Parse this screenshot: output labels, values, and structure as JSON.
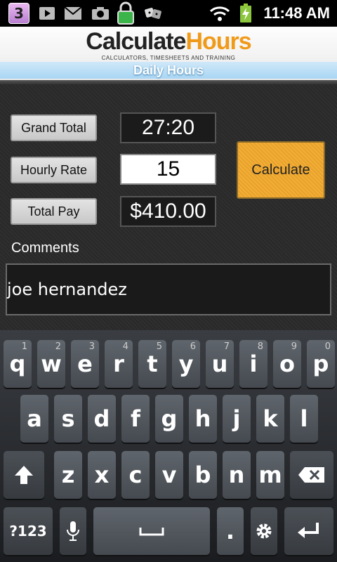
{
  "status_bar": {
    "notification_count": "3",
    "time": "11:48 AM",
    "icons": [
      "notification-badge-icon",
      "youtube-icon",
      "gmail-icon",
      "camera-icon",
      "lock-icon",
      "dice-icon",
      "wifi-icon",
      "battery-charging-icon"
    ]
  },
  "header": {
    "logo_part1": "Calculate",
    "logo_part2": "Hours",
    "tagline": "CALCULATORS, TIMESHEETS AND TRAINING",
    "subtitle": "Daily Hours",
    "brand_color": "#f09a1a"
  },
  "form": {
    "grand_total_label": "Grand Total",
    "grand_total_value": "27:20",
    "hourly_rate_label": "Hourly Rate",
    "hourly_rate_value": "15",
    "total_pay_label": "Total Pay",
    "total_pay_value": "$410.00",
    "calculate_label": "Calculate",
    "comments_label": "Comments",
    "comments_value": "joe hernandez"
  },
  "keyboard": {
    "row1": [
      {
        "key": "q",
        "hint": "1"
      },
      {
        "key": "w",
        "hint": "2"
      },
      {
        "key": "e",
        "hint": "3"
      },
      {
        "key": "r",
        "hint": "4"
      },
      {
        "key": "t",
        "hint": "5"
      },
      {
        "key": "y",
        "hint": "6"
      },
      {
        "key": "u",
        "hint": "7"
      },
      {
        "key": "i",
        "hint": "8"
      },
      {
        "key": "o",
        "hint": "9"
      },
      {
        "key": "p",
        "hint": "0"
      }
    ],
    "row2": [
      "a",
      "s",
      "d",
      "f",
      "g",
      "h",
      "j",
      "k",
      "l"
    ],
    "row3": [
      "z",
      "x",
      "c",
      "v",
      "b",
      "n",
      "m"
    ],
    "symbols_label": "?123",
    "period_label": "."
  }
}
